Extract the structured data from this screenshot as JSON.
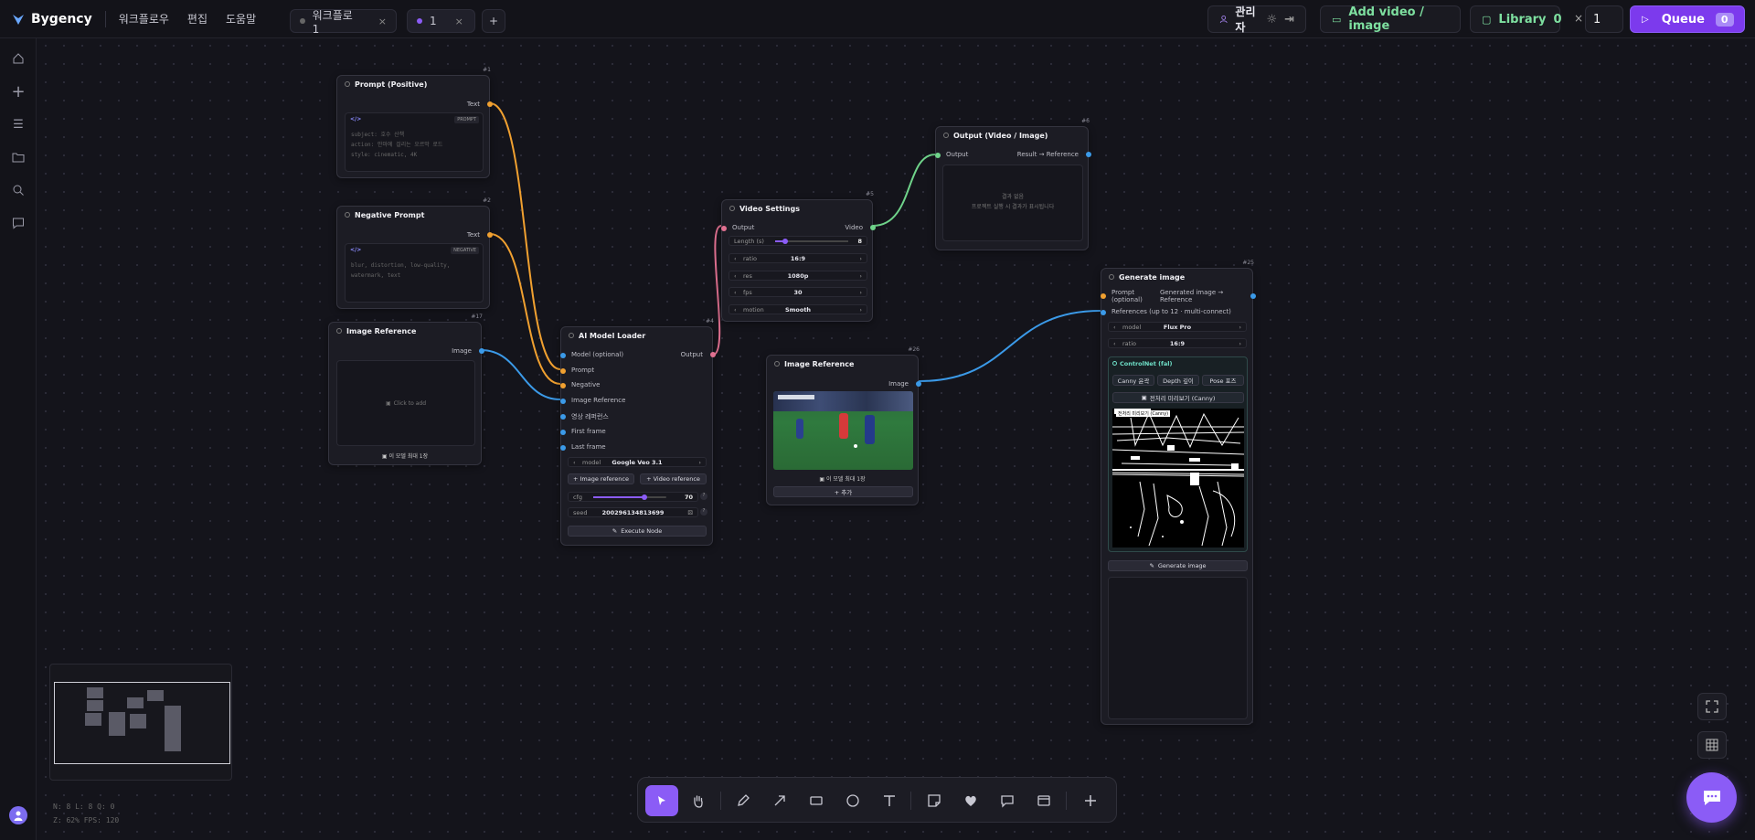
{
  "app": {
    "name": "Bygency",
    "menus": [
      "워크플로우",
      "편집",
      "도움말"
    ],
    "tabs": [
      {
        "label": "워크플로 1",
        "close": "×"
      },
      {
        "label": "1",
        "close": "×"
      }
    ],
    "new_tab": "+"
  },
  "header": {
    "user": "관리자",
    "add_video": "Add video / image",
    "library_label": "Library",
    "library_count": "0",
    "batch_x": "×",
    "batch_count": "1",
    "queue_label": "Queue",
    "queue_count": "0"
  },
  "nodes": {
    "prompt_pos": {
      "id": "#1",
      "title": "Prompt (Positive)",
      "out": "Text",
      "badge": "PROMPT",
      "code_icon": "</>",
      "lines": [
        "subject: 호수 산책",
        "action: 안마에 걸리는 오르막 로드",
        "style: cinematic, 4K"
      ]
    },
    "prompt_neg": {
      "id": "#2",
      "title": "Negative Prompt",
      "out": "Text",
      "badge": "NEGATIVE",
      "code_icon": "</>",
      "lines": [
        "blur, distortion, low-quality,",
        "watermark, text"
      ]
    },
    "img_ref1": {
      "id": "#17",
      "title": "Image Reference",
      "out": "Image",
      "drop": "Click to add",
      "footer": "이 모델 최대 1장"
    },
    "model_loader": {
      "id": "#4",
      "title": "AI Model Loader",
      "out": "Output",
      "inputs": [
        "Model (optional)",
        "Prompt",
        "Negative",
        "Image Reference",
        "영상 레퍼런스",
        "First frame",
        "Last frame"
      ],
      "model_label": "model",
      "model_value": "Google Veo 3.1",
      "img_ref_btn": "+ Image reference",
      "vid_ref_btn": "+ Video reference",
      "cfg_label": "cfg",
      "cfg_value": "70",
      "seed_label": "seed",
      "seed_value": "200296134813699",
      "execute": "Execute Node"
    },
    "video_settings": {
      "id": "#5",
      "title": "Video Settings",
      "in": "Output",
      "out": "Video",
      "length_label": "Length (s)",
      "length_value": "8",
      "rows": [
        {
          "label": "ratio",
          "value": "16:9"
        },
        {
          "label": "res",
          "value": "1080p"
        },
        {
          "label": "fps",
          "value": "30"
        },
        {
          "label": "motion",
          "value": "Smooth"
        }
      ]
    },
    "img_ref2": {
      "id": "#26",
      "title": "Image Reference",
      "out": "Image",
      "footer": "이 모델 최대 1장",
      "add": "+ 추가"
    },
    "output": {
      "id": "#6",
      "title": "Output (Video / Image)",
      "in": "Output",
      "out": "Result → Reference",
      "empty1": "결과 없음",
      "empty2": "프로젝트 실행 시 결과가 표시됩니다"
    },
    "gen_image": {
      "id": "#25",
      "title": "Generate image",
      "in1": "Prompt",
      "in1b": "(optional)",
      "out1": "Generated image →",
      "out1b": "Reference",
      "refs": "References (up to 12 · multi-connect)",
      "model_label": "model",
      "model_value": "Flux Pro",
      "ratio_label": "ratio",
      "ratio_value": "16:9",
      "controlnet": "ControlNet (fal)",
      "cn_tabs": [
        "Canny 윤곽",
        "Depth 깊이",
        "Pose 포즈"
      ],
      "preview_btn": "전처리 미리보기 (Canny)",
      "preview_title": "전처리 미리보기 (Canny)",
      "generate": "Generate image"
    }
  },
  "stats": {
    "line1": "N: 8  L: 8  Q: 0",
    "line2": "Z: 62%  FPS: 120"
  },
  "tools": [
    "pointer-icon",
    "hand-icon",
    "pen-icon",
    "arrow-icon",
    "rect-icon",
    "circle-icon",
    "text-icon",
    "sticky-icon",
    "heart-icon",
    "comment-icon",
    "frame-icon",
    "plus-icon"
  ],
  "colors": {
    "accent": "#8b5cf6",
    "wire_orange": "#f0a030",
    "wire_blue": "#3b9ae8",
    "wire_pink": "#e07090",
    "wire_green": "#6fd38a"
  }
}
